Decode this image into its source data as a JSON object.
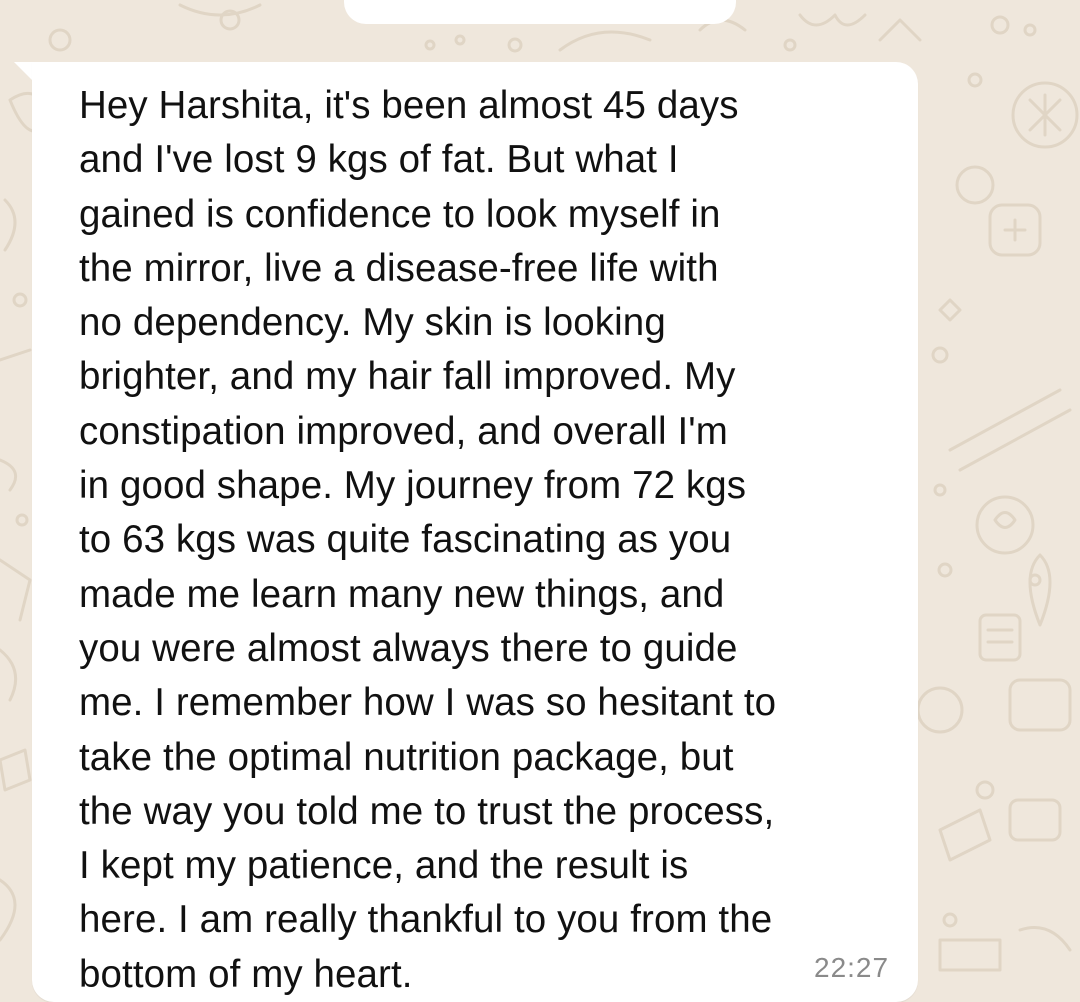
{
  "theme": {
    "wallpaper_color": "#efe7dc",
    "doodle_color": "#e0d5c5",
    "bubble_color": "#ffffff",
    "text_color": "#111111",
    "timestamp_color": "#8a8a8a"
  },
  "message": {
    "lines": [
      "Hey Harshita, it's been almost 45 days",
      "and I've lost 9 kgs of fat. But what I",
      "gained is confidence to look myself in",
      "the mirror, live a disease-free life with",
      "no dependency. My skin is looking",
      "brighter, and my hair fall improved. My",
      "constipation improved, and overall I'm",
      "in good shape. My journey from 72 kgs",
      "to 63 kgs was quite fascinating as you",
      "made me learn many new things, and",
      "you were almost always there to guide",
      "me. I remember how I was so hesitant to",
      "take the optimal nutrition package, but",
      "the way you told me to trust the process,",
      "I kept my patience, and the result is",
      "here. I am really thankful to you from the",
      "bottom of my heart."
    ],
    "timestamp": "22:27"
  }
}
